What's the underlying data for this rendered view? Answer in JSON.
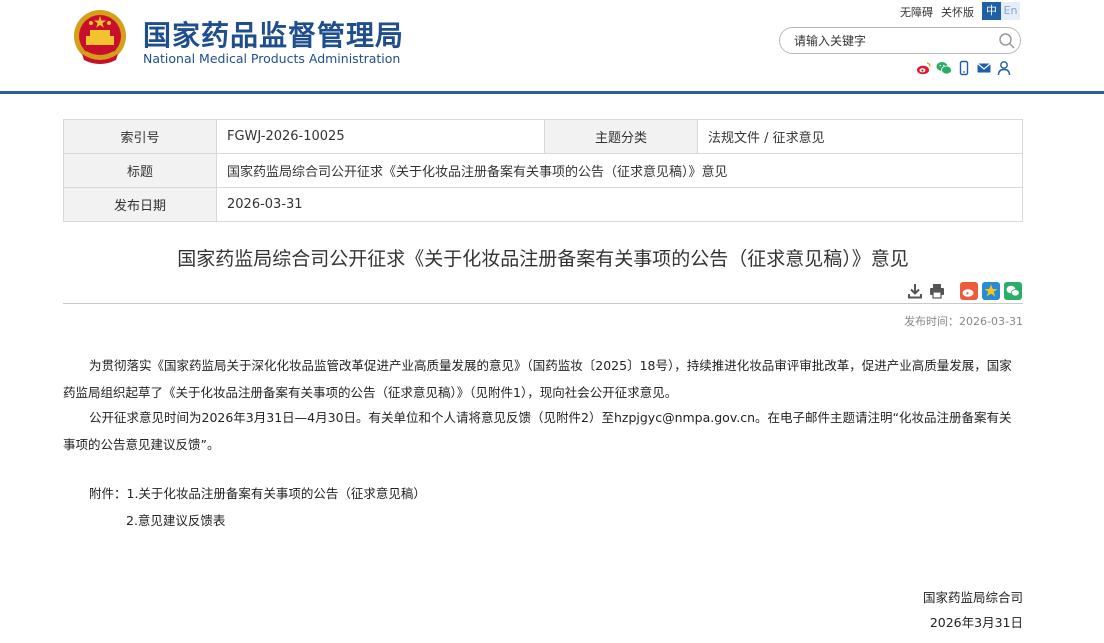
{
  "header": {
    "title_cn": "国家药品监督管理局",
    "title_en": "National Medical Products Administration",
    "accessibility": [
      "无障碍",
      "关怀版"
    ],
    "lang_zh": "中",
    "lang_en": "En",
    "search_placeholder": "请输入关键字",
    "share_icons": [
      "weibo-icon",
      "wechat-icon",
      "mobile-icon",
      "mail-icon",
      "user-icon"
    ],
    "accent_color": "#2e5e9c"
  },
  "info": {
    "index_label": "索引号",
    "index_value": "FGWJ-2026-10025",
    "category_label": "主题分类",
    "category_value": "法规文件 / 征求意见",
    "title_label": "标题",
    "title_value": "国家药监局综合司公开征求《关于化妆品注册备案有关事项的公告（征求意见稿）》意见",
    "date_label": "发布日期",
    "date_value": "2026-03-31"
  },
  "article": {
    "title": "国家药监局综合司公开征求《关于化妆品注册备案有关事项的公告（征求意见稿）》意见",
    "pub_time": "发布时间：2026-03-31",
    "tool_icons": [
      "download-icon",
      "print-icon",
      "weibo-share-icon",
      "qzone-share-icon",
      "wechat-share-icon"
    ],
    "paragraph1": "为贯彻落实《国家药监局关于深化化妆品监管改革促进产业高质量发展的意见》（国药监妆〔2025〕18号），持续推进化妆品审评审批改革，促进产业高质量发展，国家药监局组织起草了《关于化妆品注册备案有关事项的公告（征求意见稿）》（见附件1），现向社会公开征求意见。",
    "paragraph2": "公开征求意见时间为2026年3月31日—4月30日。有关单位和个人请将意见反馈（见附件2）至hzpjgyc@nmpa.gov.cn。在电子邮件主题请注明“化妆品注册备案有关事项的公告意见建议反馈”。",
    "attachment1": "附件：1.关于化妆品注册备案有关事项的公告（征求意见稿）",
    "attachment2": "2.意见建议反馈表",
    "sign_org": "国家药监局综合司",
    "sign_date": "2026年3月31日"
  }
}
